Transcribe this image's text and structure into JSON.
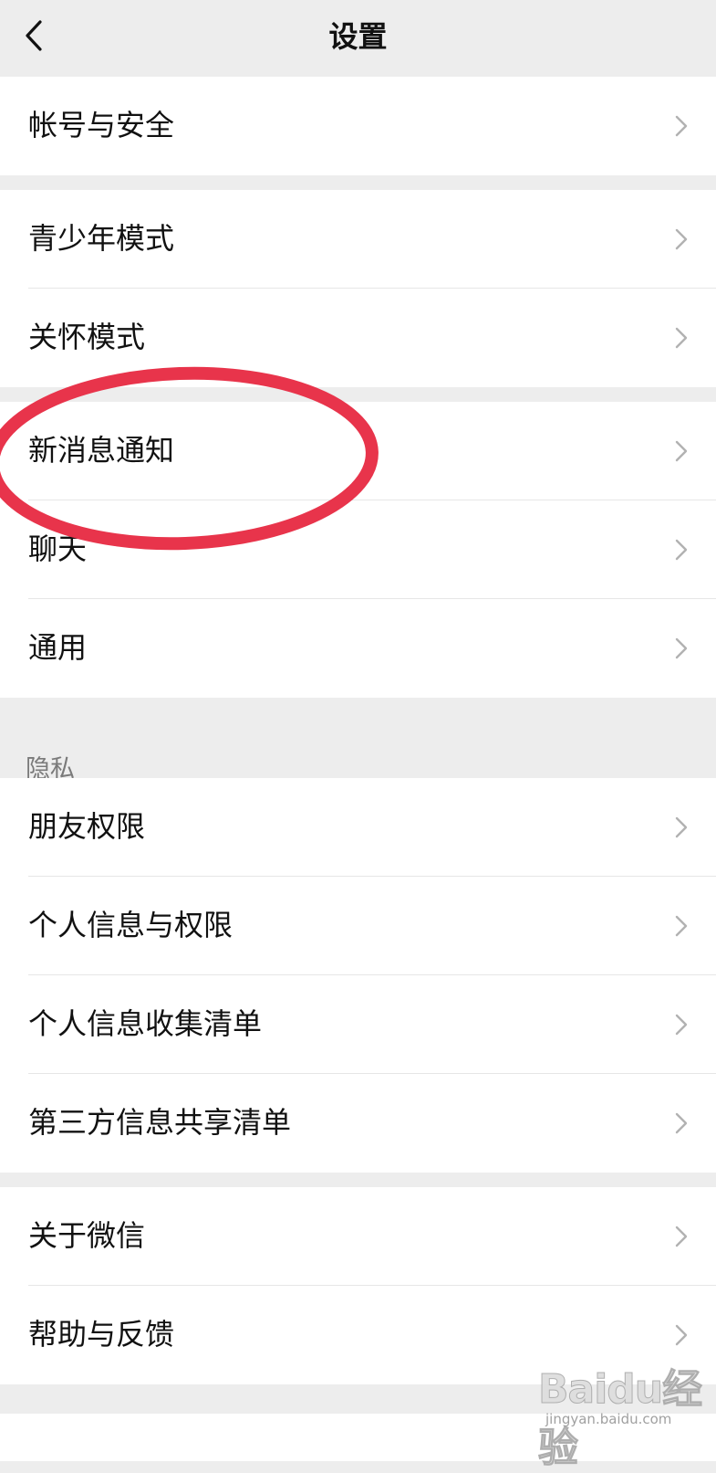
{
  "header": {
    "title": "设置",
    "back_icon": "chevron-left-icon"
  },
  "groups": [
    {
      "items": [
        {
          "label": "帐号与安全"
        }
      ]
    },
    {
      "items": [
        {
          "label": "青少年模式"
        },
        {
          "label": "关怀模式"
        }
      ]
    },
    {
      "items": [
        {
          "label": "新消息通知"
        },
        {
          "label": "聊天"
        },
        {
          "label": "通用"
        }
      ]
    },
    {
      "section_label": "隐私",
      "items": [
        {
          "label": "朋友权限"
        },
        {
          "label": "个人信息与权限"
        },
        {
          "label": "个人信息收集清单"
        },
        {
          "label": "第三方信息共享清单"
        }
      ]
    },
    {
      "items": [
        {
          "label": "关于微信"
        },
        {
          "label": "帮助与反馈"
        }
      ]
    }
  ],
  "chevron_icon": "chevron-right-icon",
  "annotation": {
    "highlighted_item": "新消息通知",
    "circle_color": "#e8344b"
  },
  "watermark": {
    "text": "Baidu经验",
    "url": "jingyan.baidu.com"
  },
  "colors": {
    "background": "#ededed",
    "row_background": "#ffffff",
    "text": "#111111",
    "section_label": "#7a7a7a",
    "divider": "#e6e6e6",
    "chevron": "#b2b2b2"
  }
}
